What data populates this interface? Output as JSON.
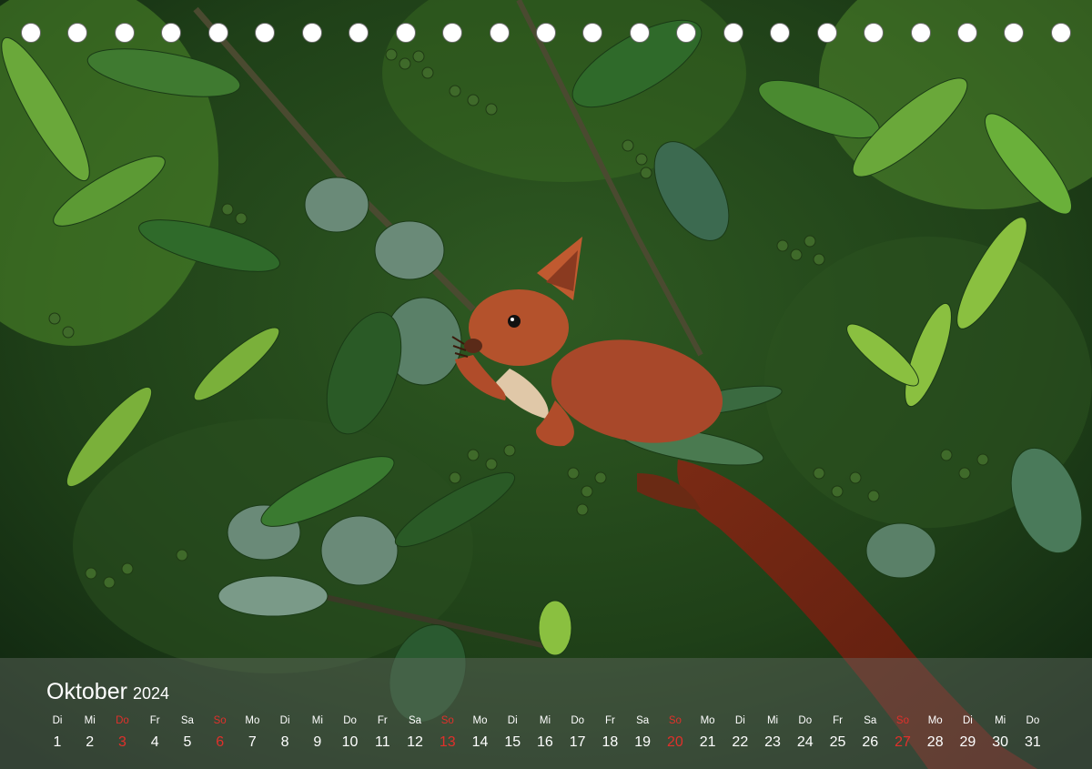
{
  "calendar": {
    "month": "Oktober",
    "year": "2024",
    "sunday_color": "#e0302b",
    "days": [
      {
        "wd": "Di",
        "d": "1"
      },
      {
        "wd": "Mi",
        "d": "2"
      },
      {
        "wd": "Do",
        "d": "3",
        "red": true
      },
      {
        "wd": "Fr",
        "d": "4"
      },
      {
        "wd": "Sa",
        "d": "5"
      },
      {
        "wd": "So",
        "d": "6",
        "red": true
      },
      {
        "wd": "Mo",
        "d": "7"
      },
      {
        "wd": "Di",
        "d": "8"
      },
      {
        "wd": "Mi",
        "d": "9"
      },
      {
        "wd": "Do",
        "d": "10"
      },
      {
        "wd": "Fr",
        "d": "11"
      },
      {
        "wd": "Sa",
        "d": "12"
      },
      {
        "wd": "So",
        "d": "13",
        "red": true
      },
      {
        "wd": "Mo",
        "d": "14"
      },
      {
        "wd": "Di",
        "d": "15"
      },
      {
        "wd": "Mi",
        "d": "16"
      },
      {
        "wd": "Do",
        "d": "17"
      },
      {
        "wd": "Fr",
        "d": "18"
      },
      {
        "wd": "Sa",
        "d": "19"
      },
      {
        "wd": "So",
        "d": "20",
        "red": true
      },
      {
        "wd": "Mo",
        "d": "21"
      },
      {
        "wd": "Di",
        "d": "22"
      },
      {
        "wd": "Mi",
        "d": "23"
      },
      {
        "wd": "Do",
        "d": "24"
      },
      {
        "wd": "Fr",
        "d": "25"
      },
      {
        "wd": "Sa",
        "d": "26"
      },
      {
        "wd": "So",
        "d": "27",
        "red": true
      },
      {
        "wd": "Mo",
        "d": "28"
      },
      {
        "wd": "Di",
        "d": "29"
      },
      {
        "wd": "Mi",
        "d": "30"
      },
      {
        "wd": "Do",
        "d": "31"
      }
    ]
  },
  "binding": {
    "hole_count": 23
  },
  "photo": {
    "subject": "red-squirrel-in-foliage"
  }
}
